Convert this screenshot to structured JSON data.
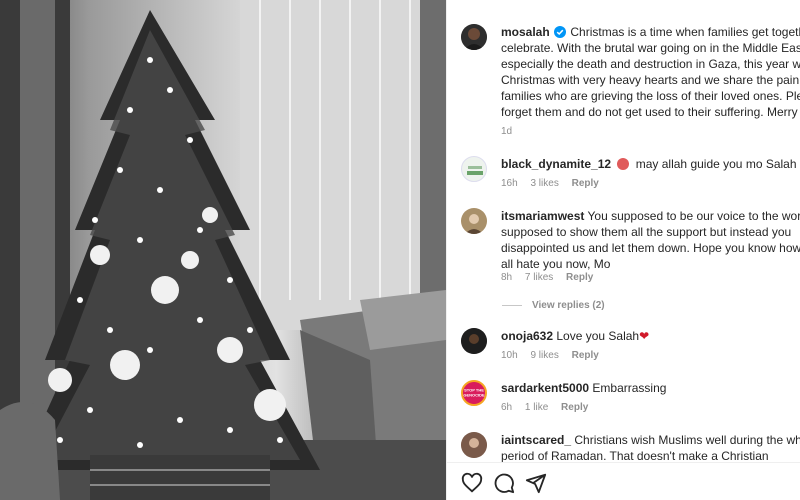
{
  "post": {
    "username": "mosalah",
    "caption": "Christmas is a time when families get together and celebrate. With the brutal war going on in the Middle East, especially the death and destruction in Gaza, this year we get to Christmas with very heavy hearts and we share the pain of those families who are grieving the loss of their loved ones. Please do not forget them and do not get used to their suffering. Merry Christmas.",
    "time": "1d"
  },
  "comments": [
    {
      "username": "black_dynamite_12",
      "text": "may allah guide you mo Salah",
      "time": "16h",
      "likes": "3 likes",
      "reply": "Reply"
    },
    {
      "username": "itsmariamwest",
      "text": "You supposed to be our voice to the world, you supposed to show them all the support but instead you disappointed us and let them down. Hope you know how bad we all hate you now, Mo",
      "time": "8h",
      "likes": "7 likes",
      "reply": "Reply"
    },
    {
      "username": "onoja632",
      "text": "Love you Salah",
      "emoji": "❤",
      "time": "10h",
      "likes": "9 likes",
      "reply": "Reply"
    },
    {
      "username": "sardarkent5000",
      "text": "Embarrassing",
      "time": "6h",
      "likes": "1 like",
      "reply": "Reply",
      "avatar_text": "STOP THE GENOCIDE"
    },
    {
      "username": "iaintscared_",
      "text": "Christians wish Muslims well during the whole festive period of Ramadan. That doesn't make a Christian",
      "time": "",
      "likes": "",
      "reply": ""
    }
  ],
  "view_replies": "View replies (2)",
  "colors": {
    "text": "#262626",
    "muted": "#8e8e8e",
    "verified": "#0095f6",
    "heart": "#d11a2a"
  }
}
